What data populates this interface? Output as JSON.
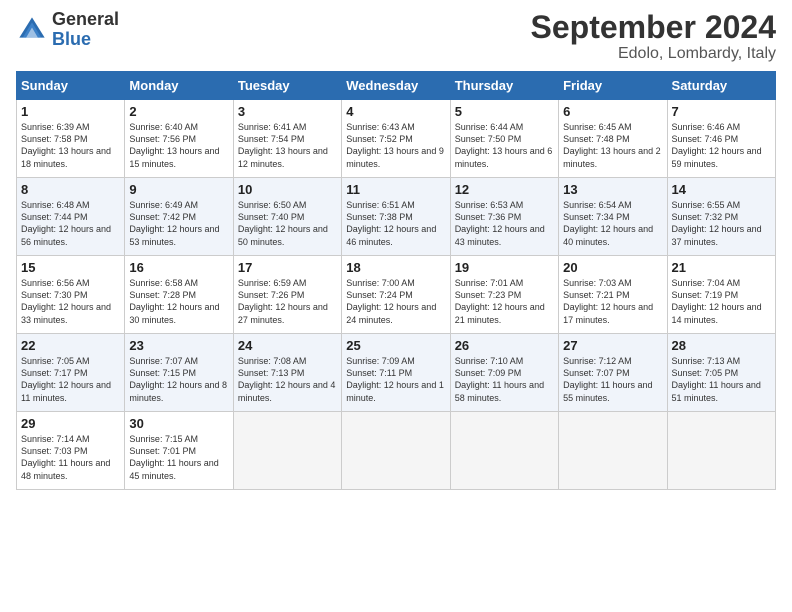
{
  "header": {
    "logo_general": "General",
    "logo_blue": "Blue",
    "month_title": "September 2024",
    "location": "Edolo, Lombardy, Italy"
  },
  "days_of_week": [
    "Sunday",
    "Monday",
    "Tuesday",
    "Wednesday",
    "Thursday",
    "Friday",
    "Saturday"
  ],
  "weeks": [
    [
      {
        "day": "1",
        "sunrise": "6:39 AM",
        "sunset": "7:58 PM",
        "daylight": "13 hours and 18 minutes."
      },
      {
        "day": "2",
        "sunrise": "6:40 AM",
        "sunset": "7:56 PM",
        "daylight": "13 hours and 15 minutes."
      },
      {
        "day": "3",
        "sunrise": "6:41 AM",
        "sunset": "7:54 PM",
        "daylight": "13 hours and 12 minutes."
      },
      {
        "day": "4",
        "sunrise": "6:43 AM",
        "sunset": "7:52 PM",
        "daylight": "13 hours and 9 minutes."
      },
      {
        "day": "5",
        "sunrise": "6:44 AM",
        "sunset": "7:50 PM",
        "daylight": "13 hours and 6 minutes."
      },
      {
        "day": "6",
        "sunrise": "6:45 AM",
        "sunset": "7:48 PM",
        "daylight": "13 hours and 2 minutes."
      },
      {
        "day": "7",
        "sunrise": "6:46 AM",
        "sunset": "7:46 PM",
        "daylight": "12 hours and 59 minutes."
      }
    ],
    [
      {
        "day": "8",
        "sunrise": "6:48 AM",
        "sunset": "7:44 PM",
        "daylight": "12 hours and 56 minutes."
      },
      {
        "day": "9",
        "sunrise": "6:49 AM",
        "sunset": "7:42 PM",
        "daylight": "12 hours and 53 minutes."
      },
      {
        "day": "10",
        "sunrise": "6:50 AM",
        "sunset": "7:40 PM",
        "daylight": "12 hours and 50 minutes."
      },
      {
        "day": "11",
        "sunrise": "6:51 AM",
        "sunset": "7:38 PM",
        "daylight": "12 hours and 46 minutes."
      },
      {
        "day": "12",
        "sunrise": "6:53 AM",
        "sunset": "7:36 PM",
        "daylight": "12 hours and 43 minutes."
      },
      {
        "day": "13",
        "sunrise": "6:54 AM",
        "sunset": "7:34 PM",
        "daylight": "12 hours and 40 minutes."
      },
      {
        "day": "14",
        "sunrise": "6:55 AM",
        "sunset": "7:32 PM",
        "daylight": "12 hours and 37 minutes."
      }
    ],
    [
      {
        "day": "15",
        "sunrise": "6:56 AM",
        "sunset": "7:30 PM",
        "daylight": "12 hours and 33 minutes."
      },
      {
        "day": "16",
        "sunrise": "6:58 AM",
        "sunset": "7:28 PM",
        "daylight": "12 hours and 30 minutes."
      },
      {
        "day": "17",
        "sunrise": "6:59 AM",
        "sunset": "7:26 PM",
        "daylight": "12 hours and 27 minutes."
      },
      {
        "day": "18",
        "sunrise": "7:00 AM",
        "sunset": "7:24 PM",
        "daylight": "12 hours and 24 minutes."
      },
      {
        "day": "19",
        "sunrise": "7:01 AM",
        "sunset": "7:23 PM",
        "daylight": "12 hours and 21 minutes."
      },
      {
        "day": "20",
        "sunrise": "7:03 AM",
        "sunset": "7:21 PM",
        "daylight": "12 hours and 17 minutes."
      },
      {
        "day": "21",
        "sunrise": "7:04 AM",
        "sunset": "7:19 PM",
        "daylight": "12 hours and 14 minutes."
      }
    ],
    [
      {
        "day": "22",
        "sunrise": "7:05 AM",
        "sunset": "7:17 PM",
        "daylight": "12 hours and 11 minutes."
      },
      {
        "day": "23",
        "sunrise": "7:07 AM",
        "sunset": "7:15 PM",
        "daylight": "12 hours and 8 minutes."
      },
      {
        "day": "24",
        "sunrise": "7:08 AM",
        "sunset": "7:13 PM",
        "daylight": "12 hours and 4 minutes."
      },
      {
        "day": "25",
        "sunrise": "7:09 AM",
        "sunset": "7:11 PM",
        "daylight": "12 hours and 1 minute."
      },
      {
        "day": "26",
        "sunrise": "7:10 AM",
        "sunset": "7:09 PM",
        "daylight": "11 hours and 58 minutes."
      },
      {
        "day": "27",
        "sunrise": "7:12 AM",
        "sunset": "7:07 PM",
        "daylight": "11 hours and 55 minutes."
      },
      {
        "day": "28",
        "sunrise": "7:13 AM",
        "sunset": "7:05 PM",
        "daylight": "11 hours and 51 minutes."
      }
    ],
    [
      {
        "day": "29",
        "sunrise": "7:14 AM",
        "sunset": "7:03 PM",
        "daylight": "11 hours and 48 minutes."
      },
      {
        "day": "30",
        "sunrise": "7:15 AM",
        "sunset": "7:01 PM",
        "daylight": "11 hours and 45 minutes."
      },
      null,
      null,
      null,
      null,
      null
    ]
  ],
  "labels": {
    "sunrise": "Sunrise:",
    "sunset": "Sunset:",
    "daylight": "Daylight:"
  }
}
